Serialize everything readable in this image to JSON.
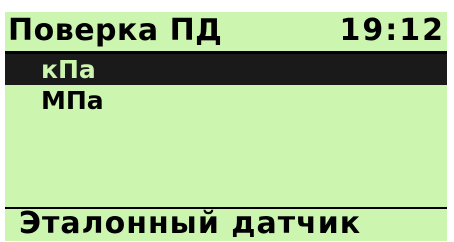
{
  "header": {
    "title": "Поверка ПД",
    "time": "19:12"
  },
  "menu": {
    "items": [
      {
        "label": "кПа",
        "selected": true
      },
      {
        "label": "МПа",
        "selected": false
      }
    ]
  },
  "footer": {
    "label": "Эталонный датчик"
  },
  "colors": {
    "screen_background": "#ccf5b0",
    "selection_background": "#1a1a1a",
    "text": "#000000"
  }
}
